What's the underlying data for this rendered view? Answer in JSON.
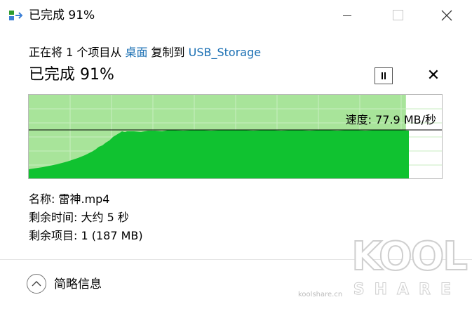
{
  "window": {
    "title": "已完成 91%",
    "app_icon": "copy-files-icon",
    "controls": [
      "minimize-icon",
      "maximize-icon",
      "close-icon"
    ]
  },
  "operation": {
    "prefix": "正在将 1 个项目从 ",
    "source": "桌面",
    "middle": " 复制到 ",
    "destination": "USB_Storage"
  },
  "progress": {
    "title": "已完成 91%",
    "percent": 91,
    "speed_label": "速度: 77.9 MB/秒"
  },
  "buttons": {
    "pause_icon": "pause-icon",
    "cancel_icon": "cancel-x-icon"
  },
  "details": {
    "name_line": "名称: 雷神.mp4",
    "time_line": "剩余时间: 大约 5 秒",
    "items_line": "剩余项目: 1 (187 MB)"
  },
  "footer": {
    "toggle_icon": "chevron-up-icon",
    "label": "简略信息"
  },
  "watermark": {
    "big": "KOOL",
    "share": "SHARE",
    "url": "koolshare.cn"
  },
  "colors": {
    "done_area": "#a8e49a",
    "speed_fill": "#10c230",
    "link": "#1a6fb3"
  }
}
